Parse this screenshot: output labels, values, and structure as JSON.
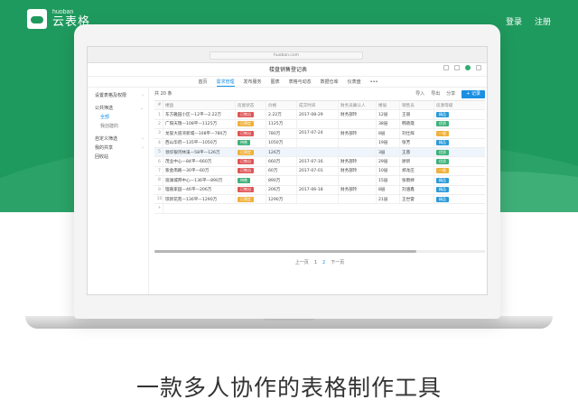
{
  "brand": {
    "small": "huoban",
    "name": "云表格"
  },
  "nav": {
    "login": "登录",
    "register": "注册"
  },
  "browser": {
    "url": "huoban.com"
  },
  "doc": {
    "title": "楼盘销售登记表"
  },
  "tabs": [
    "首页",
    "需求管理",
    "发布服务",
    "图表",
    "表格与动态",
    "数据仓库",
    "仪表盘",
    "•••"
  ],
  "sidebar": {
    "settings": "设置表格及权限",
    "public_filter": "公共筛选",
    "all": "全部",
    "mine": "我创建的",
    "custom_filter": "自定义筛选",
    "my_share": "我的共享",
    "recycle": "回收站"
  },
  "toolbar": {
    "count": "共 20 条",
    "import": "导入",
    "export": "导出",
    "share": "分享",
    "add": "+ 记录"
  },
  "columns": [
    "#",
    "楼盘",
    "房屋状态",
    "价格",
    "成交时间",
    "财务员确认人",
    "楼层",
    "销售员",
    "房源等级"
  ],
  "rows": [
    {
      "n": "1",
      "name": "东方雅园小区—12平—2.22万",
      "status": "已售出",
      "status_color": "#e05656",
      "price": "2.22万",
      "date": "2017-08-29",
      "confirm": "财务部玲",
      "floor": "12层",
      "sales": "王丽",
      "grade": "精品",
      "grade_color": "#2c9ad8"
    },
    {
      "n": "2",
      "name": "广阳天瑞—108平—1125万",
      "status": "已预定",
      "status_color": "#f0b13a",
      "price": "1125万",
      "date": "",
      "confirm": "",
      "floor": "38层",
      "sales": "韩晓霞",
      "grade": "优质",
      "grade_color": "#3fb27a"
    },
    {
      "n": "3",
      "name": "龙誉大道湾新城—108平—780万",
      "status": "已售出",
      "status_color": "#e05656",
      "price": "780万",
      "date": "2017-07-24",
      "confirm": "财务部玲",
      "floor": "8层",
      "sales": "刘仕辉",
      "grade": "一般",
      "grade_color": "#f0b13a"
    },
    {
      "n": "4",
      "name": "西山华府—135平—1050万",
      "status": "待售",
      "status_color": "#3fb27a",
      "price": "1050万",
      "date": "",
      "confirm": "",
      "floor": "19层",
      "sales": "张芳",
      "grade": "精品",
      "grade_color": "#2c9ad8"
    },
    {
      "n": "5",
      "name": "领华银河林溪—58平—126万",
      "status": "已预定",
      "status_color": "#f0b13a",
      "price": "126万",
      "date": "",
      "confirm": "",
      "floor": "3层",
      "sales": "王蓉",
      "grade": "优质",
      "grade_color": "#3fb27a"
    },
    {
      "n": "6",
      "name": "茂业中心—84平—660万",
      "status": "已售出",
      "status_color": "#e05656",
      "price": "660万",
      "date": "2017-07-16",
      "confirm": "财务部玲",
      "floor": "29层",
      "sales": "廖新",
      "grade": "优质",
      "grade_color": "#3fb27a"
    },
    {
      "n": "7",
      "name": "紫金南路—30平—60万",
      "status": "已售出",
      "status_color": "#e05656",
      "price": "60万",
      "date": "2017-07-01",
      "confirm": "财务部玲",
      "floor": "10层",
      "sales": "郑龙庄",
      "grade": "一般",
      "grade_color": "#f0b13a"
    },
    {
      "n": "8",
      "name": "观湖城邦中心—136平—890万",
      "status": "待售",
      "status_color": "#3fb27a",
      "price": "890万",
      "date": "",
      "confirm": "",
      "floor": "15层",
      "sales": "张雨婷",
      "grade": "精品",
      "grade_color": "#2c9ad8"
    },
    {
      "n": "9",
      "name": "理嘉家园—46平—206万",
      "status": "已售出",
      "status_color": "#e05656",
      "price": "206万",
      "date": "2017-06-18",
      "confirm": "财务部玲",
      "floor": "8层",
      "sales": "刘涵鑫",
      "grade": "精品",
      "grade_color": "#2c9ad8"
    },
    {
      "n": "10",
      "name": "琼新花苑—136平—1290万",
      "status": "已预定",
      "status_color": "#f0b13a",
      "price": "1290万",
      "date": "",
      "confirm": "",
      "floor": "21层",
      "sales": "王世雷",
      "grade": "精品",
      "grade_color": "#2c9ad8"
    }
  ],
  "new_row_marker": "+",
  "pager": {
    "prev": "上一页",
    "p1": "1",
    "p2": "2",
    "next": "下一页"
  },
  "slogan": "一款多人协作的表格制作工具"
}
